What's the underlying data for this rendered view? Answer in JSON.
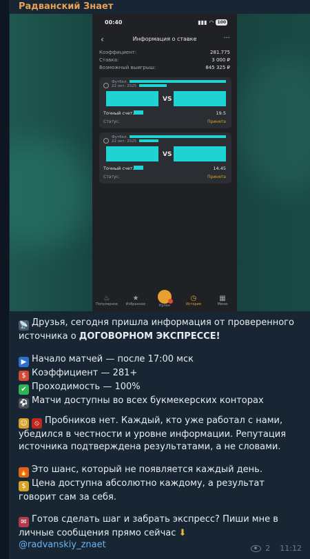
{
  "channel": {
    "name": "Радванский Знает"
  },
  "screenshot": {
    "status_time": "00:40",
    "battery": "100",
    "nav_title": "Информация о ставке",
    "info": [
      {
        "label": "Коэффициент:",
        "value": "281.775"
      },
      {
        "label": "Ставка:",
        "value": "3 000 ₽"
      },
      {
        "label": "Возможный выигрыш:",
        "value": "845 325 ₽"
      }
    ],
    "cards": [
      {
        "sport": "Футбол.",
        "date": "22 окт. 2025",
        "vs": "VS",
        "market": "Точный счет.",
        "odds": "19.5",
        "status_label": "Статус:",
        "status_value": "Принята"
      },
      {
        "sport": "Футбол.",
        "date": "22 окт. 2025",
        "vs": "VS",
        "market": "Точный счет.",
        "odds": "14.45",
        "status_label": "Статус:",
        "status_value": "Принята"
      }
    ],
    "tabs": [
      {
        "label": "Популярное",
        "icon": "fire-icon"
      },
      {
        "label": "Избранное",
        "icon": "star-icon"
      },
      {
        "label": "Купон",
        "icon": "ticket-icon"
      },
      {
        "label": "История",
        "icon": "clock-icon"
      },
      {
        "label": "Меню",
        "icon": "grid-icon"
      }
    ]
  },
  "message": {
    "p1_a": "Друзья, сегодня пришла информация от проверенного источника о ",
    "p1_b": "ДОГОВОРНОМ ЭКСПРЕССЕ!",
    "p2": [
      "Начало матчей — после 17:00 мск",
      "Коэффициент — 281+",
      "Проходимость — 100%",
      "Матчи доступны во всех букмекерских конторах"
    ],
    "p3": "Пробников нет. Каждый, кто уже работал с нами, убедился в честности и уровне информации. Репутация источника подтверждена результатами, а не словами.",
    "p4_a": "Это шанс, который не появляется каждый день.",
    "p4_b": "Цена доступна абсолютно каждому, а результат говорит сам за себя.",
    "p5": "Готов сделать шаг и забрать экспресс? Пиши мне в личные сообщения прямо сейчас",
    "link": "@radvanskiy_znaet"
  },
  "meta": {
    "views": "2",
    "time": "11:12"
  },
  "colors": {
    "accent": "#e8a033",
    "link": "#6ab3f3",
    "cover": "#20d3d3"
  }
}
